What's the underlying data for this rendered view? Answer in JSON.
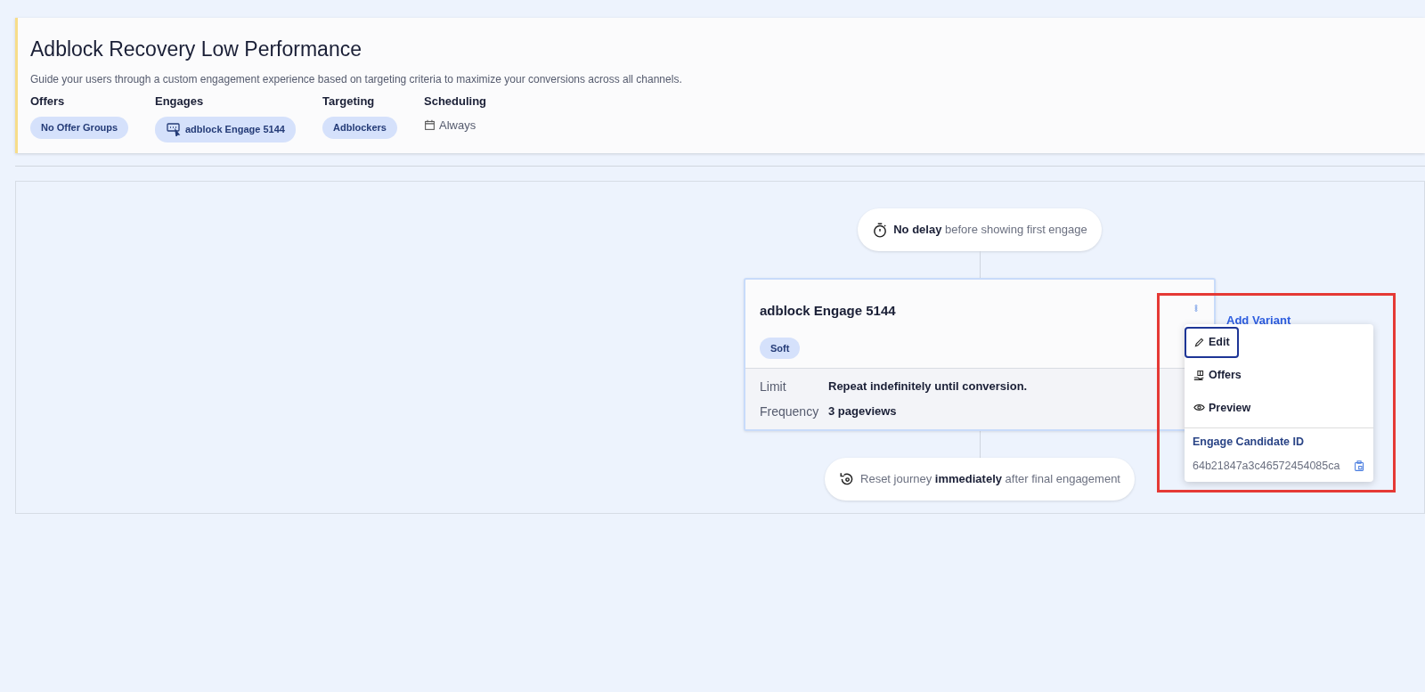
{
  "header": {
    "title": "Adblock Recovery Low Performance",
    "description": "Guide your users through a custom engagement experience based on targeting criteria to maximize your conversions across all channels.",
    "fields": [
      {
        "label": "Offers",
        "kind": "pill",
        "value": "No Offer Groups"
      },
      {
        "label": "Engages",
        "kind": "engage",
        "value": "adblock Engage 5144"
      },
      {
        "label": "Targeting",
        "kind": "pill",
        "value": "Adblockers"
      },
      {
        "label": "Scheduling",
        "kind": "schedule",
        "value": "Always"
      }
    ]
  },
  "journey": {
    "start": "**No delay** before showing first engage",
    "engage": {
      "title": "adblock Engage 5144",
      "tag": "Soft",
      "details": [
        {
          "label": "Limit",
          "value": "Repeat indefinitely until conversion."
        },
        {
          "label": "Frequency",
          "value": "3 pageviews"
        }
      ]
    },
    "add_variant": "Add Variant",
    "end": "Reset journey **immediately** after final engagement"
  },
  "menu": {
    "items": [
      {
        "label": "Edit",
        "kind": "edit",
        "selected": true
      },
      {
        "label": "Offers",
        "kind": "offers",
        "selected": false
      },
      {
        "label": "Preview",
        "kind": "preview",
        "selected": false
      }
    ],
    "id_label": "Engage Candidate ID",
    "id_value": "64b21847a3c46572454085ca"
  },
  "highlight": true
}
